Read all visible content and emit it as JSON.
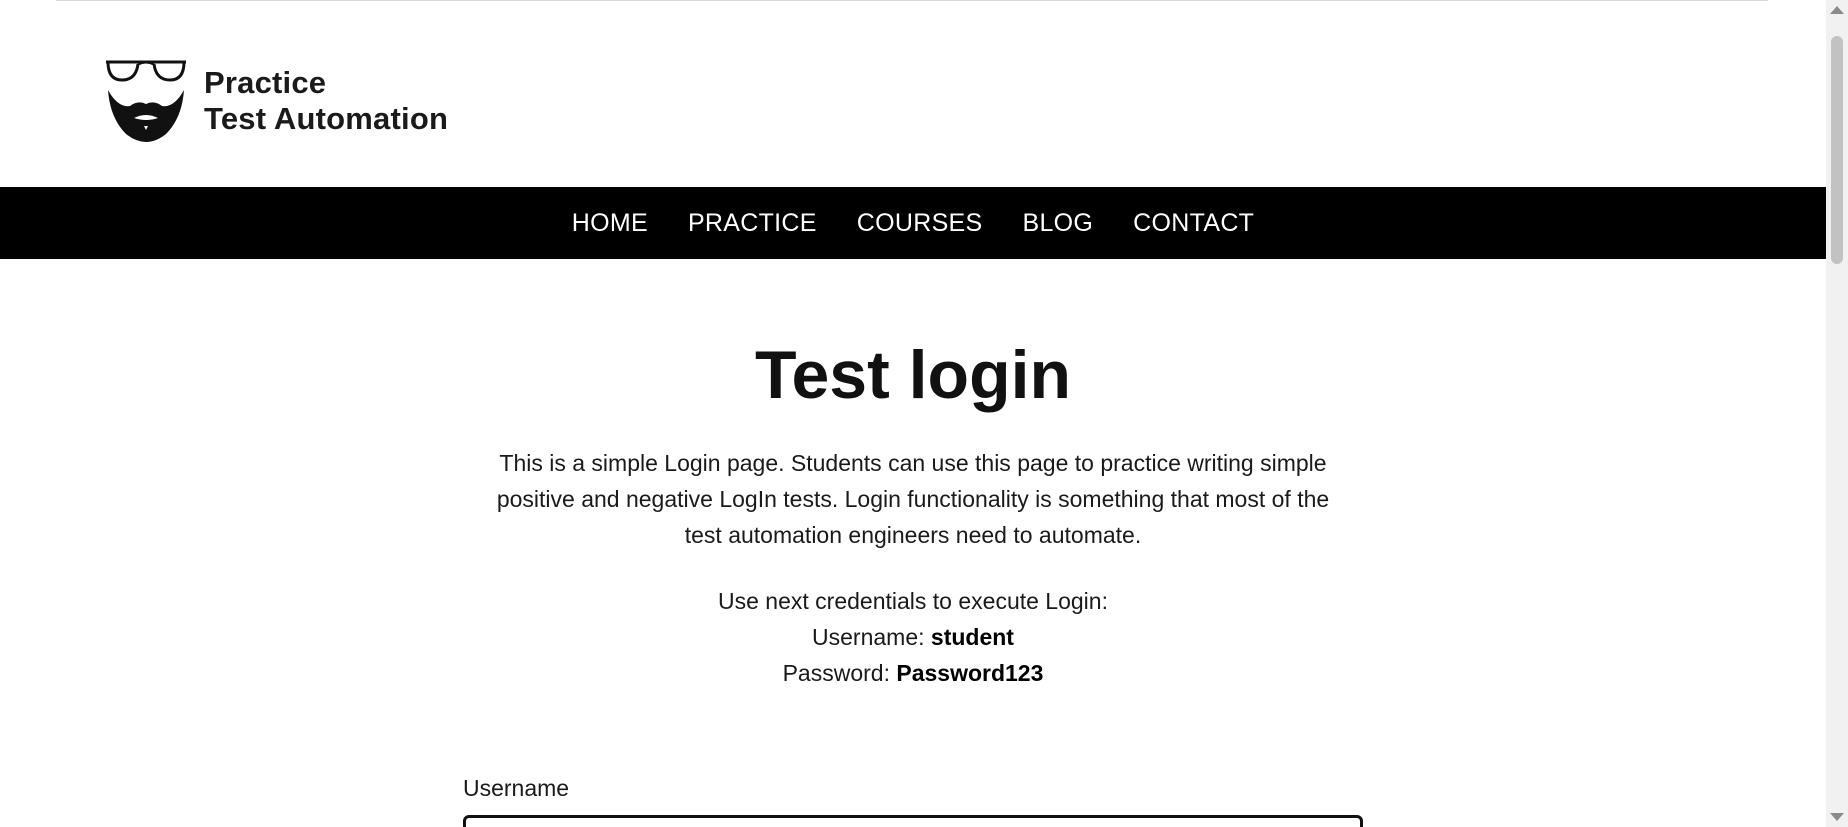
{
  "brand": {
    "line1": "Practice",
    "line2": "Test Automation",
    "logo_icon": "glasses-beard-logo"
  },
  "nav": {
    "items": [
      {
        "label": "HOME"
      },
      {
        "label": "PRACTICE"
      },
      {
        "label": "COURSES"
      },
      {
        "label": "BLOG"
      },
      {
        "label": "CONTACT"
      }
    ]
  },
  "main": {
    "title": "Test login",
    "intro": "This is a simple Login page. Students can use this page to practice writing simple positive and negative LogIn tests. Login functionality is something that most of the test automation engineers need to automate.",
    "credentials_heading": "Use next credentials to execute Login:",
    "username_label": "Username:",
    "username_value": "student",
    "password_label": "Password:",
    "password_value": "Password123"
  },
  "form": {
    "username_field_label": "Username",
    "username_field_value": ""
  },
  "colors": {
    "navbar_bg": "#000000",
    "nav_text": "#ffffff",
    "text": "#111111"
  }
}
